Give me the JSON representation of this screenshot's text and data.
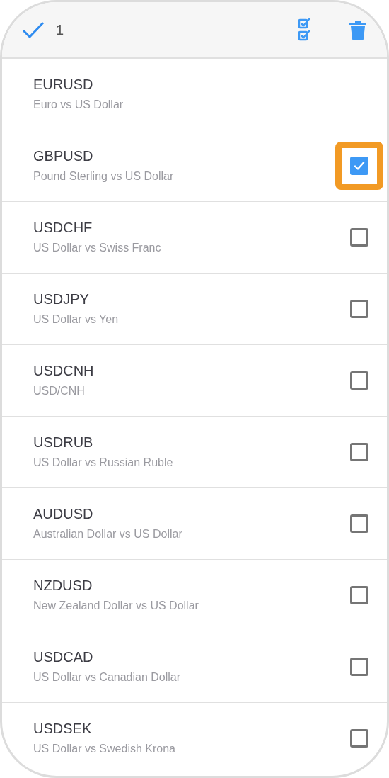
{
  "header": {
    "count": "1"
  },
  "rows": [
    {
      "kind": "fixed",
      "symbol": "EURUSD",
      "description": "Euro vs US Dollar"
    },
    {
      "kind": "selectable",
      "symbol": "GBPUSD",
      "description": "Pound Sterling vs US Dollar",
      "checked": true,
      "highlighted": true
    },
    {
      "kind": "selectable",
      "symbol": "USDCHF",
      "description": "US Dollar vs Swiss Franc",
      "checked": false,
      "highlighted": false
    },
    {
      "kind": "selectable",
      "symbol": "USDJPY",
      "description": "US Dollar vs Yen",
      "checked": false,
      "highlighted": false
    },
    {
      "kind": "selectable",
      "symbol": "USDCNH",
      "description": "USD/CNH",
      "checked": false,
      "highlighted": false
    },
    {
      "kind": "selectable",
      "symbol": "USDRUB",
      "description": "US Dollar vs Russian Ruble",
      "checked": false,
      "highlighted": false
    },
    {
      "kind": "selectable",
      "symbol": "AUDUSD",
      "description": "Australian Dollar vs US Dollar",
      "checked": false,
      "highlighted": false
    },
    {
      "kind": "selectable",
      "symbol": "NZDUSD",
      "description": "New Zealand Dollar vs US Dollar",
      "checked": false,
      "highlighted": false
    },
    {
      "kind": "selectable",
      "symbol": "USDCAD",
      "description": "US Dollar vs Canadian Dollar",
      "checked": false,
      "highlighted": false
    },
    {
      "kind": "selectable",
      "symbol": "USDSEK",
      "description": "US Dollar vs Swedish Krona",
      "checked": false,
      "highlighted": false
    }
  ]
}
